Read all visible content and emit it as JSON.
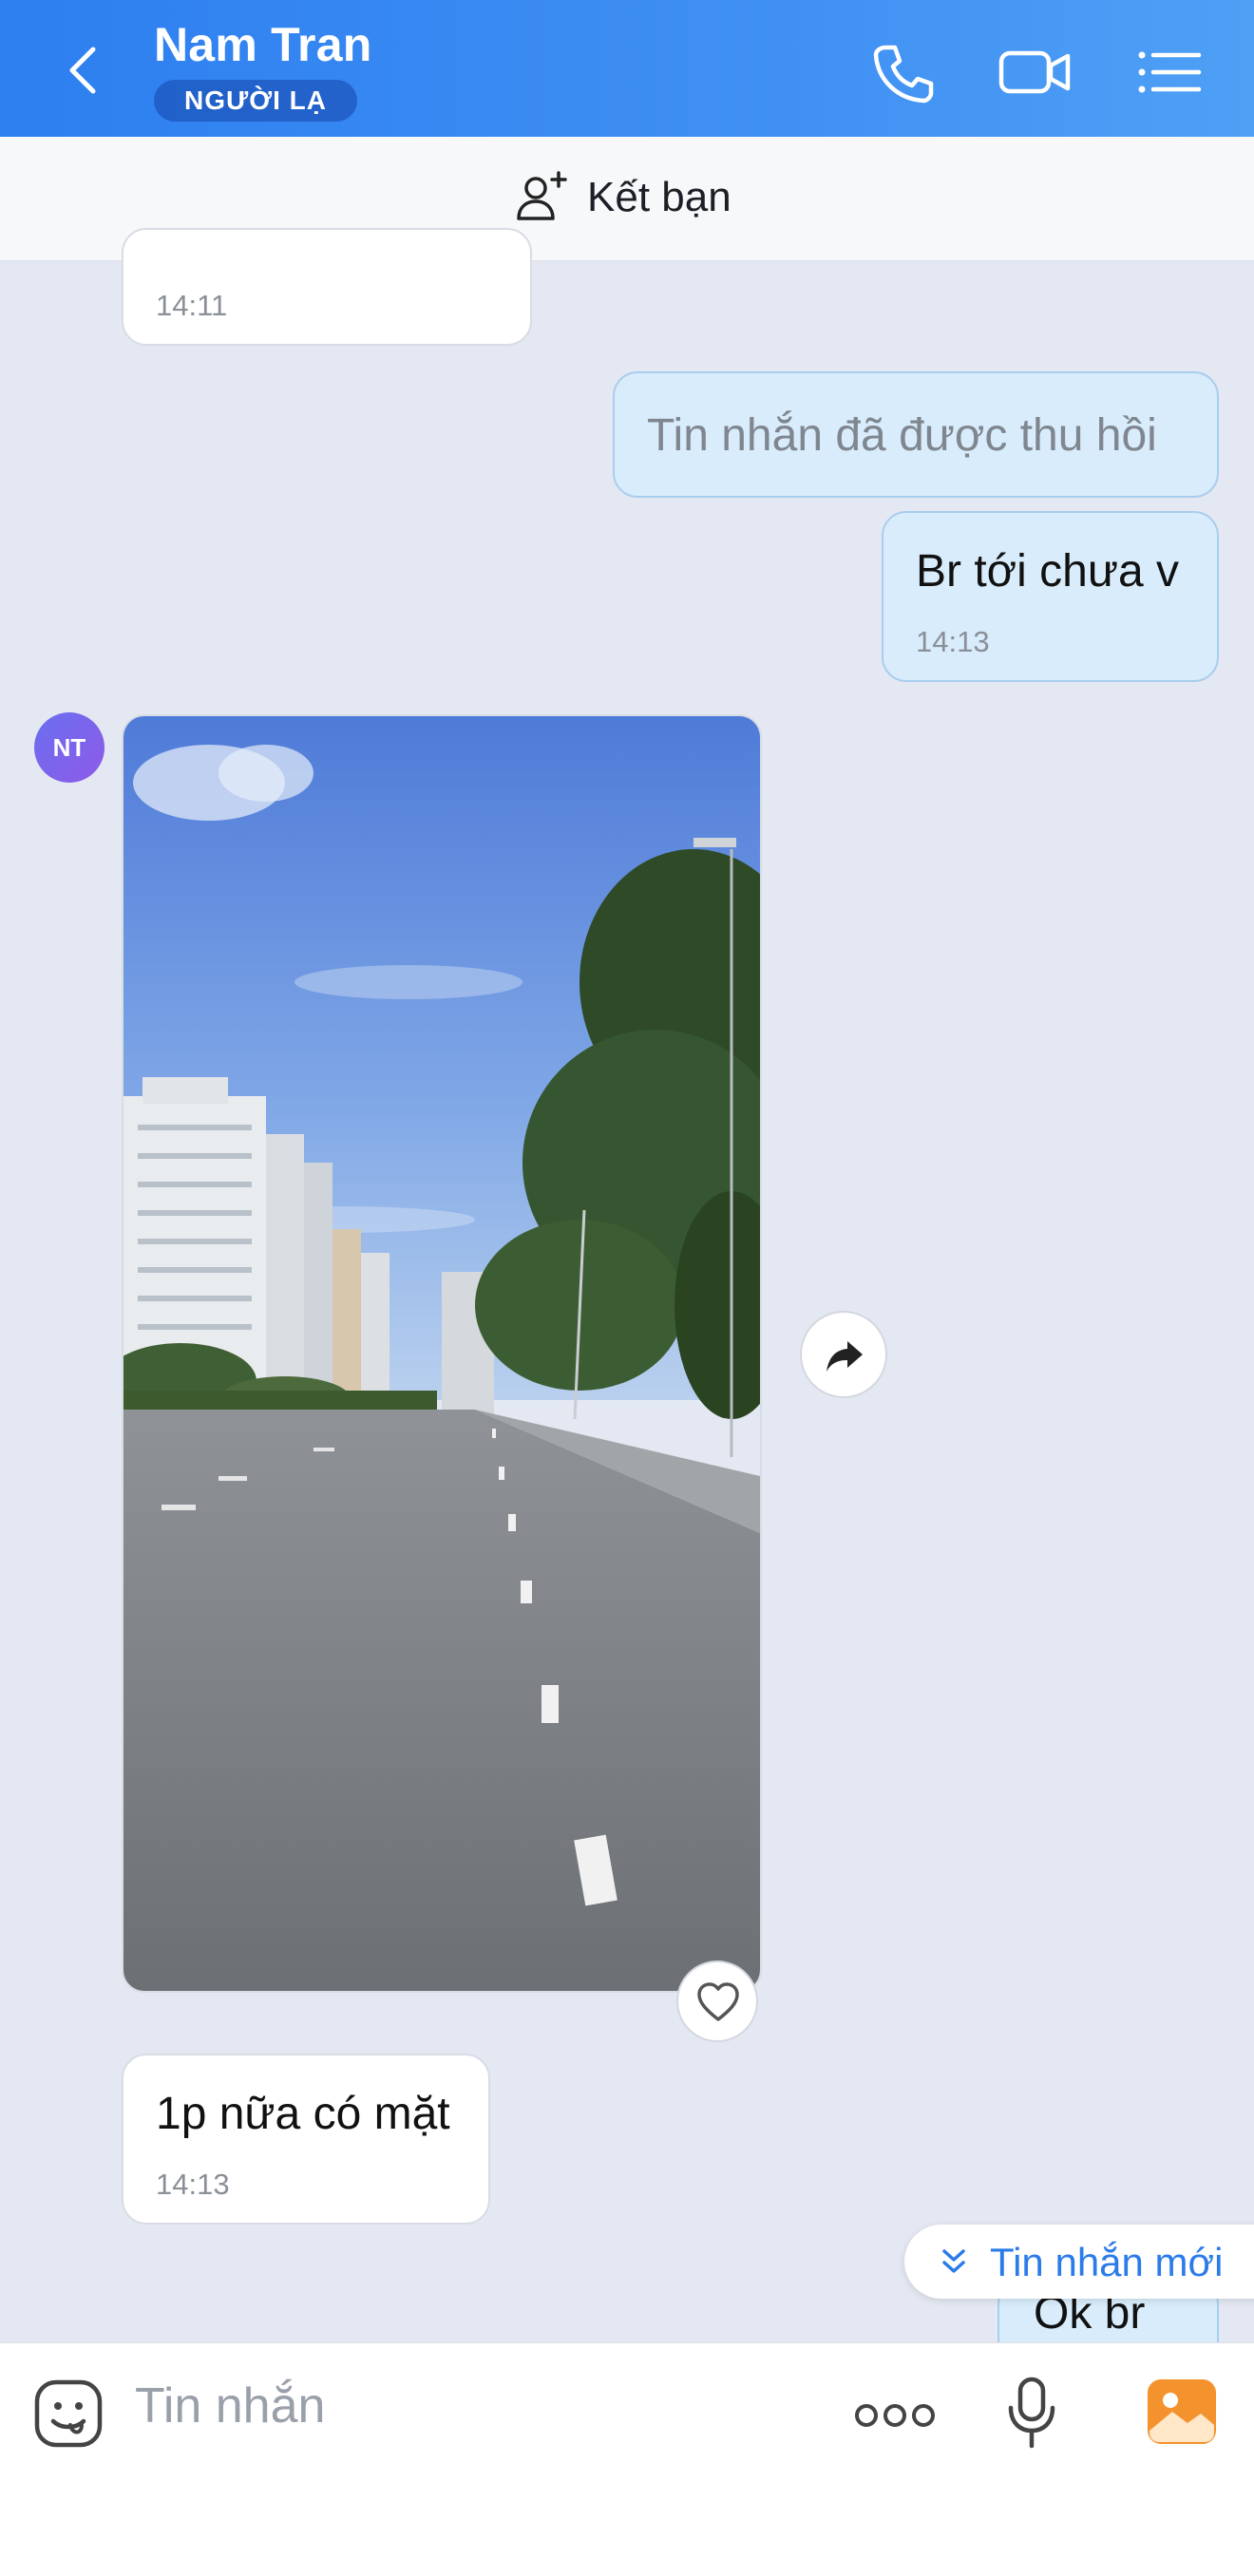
{
  "header": {
    "title": "Nam Tran",
    "badge": "NGƯỜI LẠ"
  },
  "friend_bar": {
    "label": "Kết bạn"
  },
  "messages": {
    "m0": {
      "time": "14:11"
    },
    "m1": {
      "text": "Tin nhắn đã được thu hồi"
    },
    "m2": {
      "text": "Br tới chưa v",
      "time": "14:13"
    },
    "m3": {
      "avatar_initials": "NT"
    },
    "m4": {
      "text": "1p nữa có mặt",
      "time": "14:13"
    },
    "m5": {
      "text": "Ok br"
    }
  },
  "new_messages": {
    "label": "Tin nhắn mới"
  },
  "composer": {
    "placeholder": "Tin nhắn"
  },
  "colors": {
    "header": "#3a8cf2",
    "accent": "#2b7be9",
    "outgoing_bubble": "#d8ecfb",
    "background": "#e4e8f2",
    "image_button": "#f4922e"
  },
  "icons": [
    "back-arrow-icon",
    "phone-icon",
    "video-call-icon",
    "menu-list-icon",
    "add-friend-icon",
    "share-forward-icon",
    "heart-icon",
    "double-chevron-down-icon",
    "emoji-icon",
    "more-dots-icon",
    "microphone-icon",
    "image-icon"
  ]
}
